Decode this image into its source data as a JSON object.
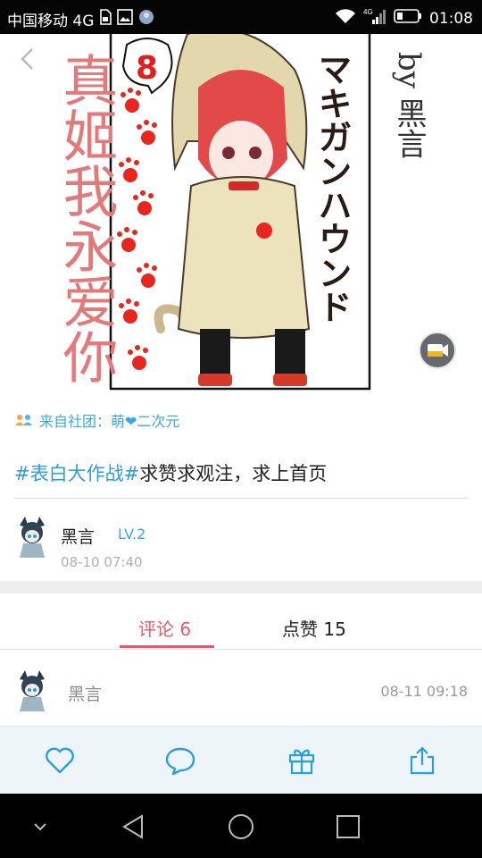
{
  "status_bar": {
    "carrier": "中国移动 4G",
    "time": "01:08",
    "network": "4G",
    "icons": [
      "sim-icon",
      "gallery-icon",
      "app-avatar-icon",
      "wifi-icon",
      "signal-icon",
      "battery-icon"
    ]
  },
  "artwork": {
    "number_badge": "8",
    "side_text_left": "真姬我永爱你",
    "side_text_right": "マキガンハウンド",
    "signature": "by 黑言"
  },
  "club": {
    "label": "来自社团：萌❤二次元"
  },
  "post": {
    "hashtag": "#表白大作战#",
    "text": "求赞求观注，求上首页"
  },
  "author": {
    "name": "黑言",
    "level": "LV.2",
    "time": "08-10 07:40"
  },
  "tabs": {
    "comments": "评论 6",
    "likes": "点赞 15"
  },
  "comments": [
    {
      "name": "黑言",
      "time": "08-11 09:18"
    }
  ],
  "colors": {
    "accent_red": "#e65a6c",
    "accent_blue": "#3aa7e4",
    "icon_blue": "#2a9fe0"
  }
}
